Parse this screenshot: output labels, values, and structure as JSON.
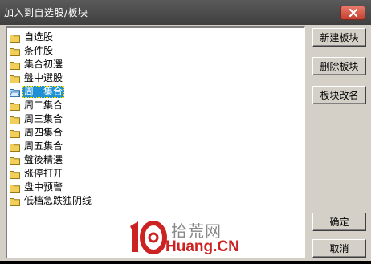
{
  "window": {
    "title": "加入到自选股/板块",
    "close_icon": "close-x-icon"
  },
  "tree": {
    "items": [
      {
        "label": "自选股",
        "icon": "folder-icon",
        "selected": false
      },
      {
        "label": "条件股",
        "icon": "folder-icon",
        "selected": false
      },
      {
        "label": "集合初選",
        "icon": "folder-icon",
        "selected": false
      },
      {
        "label": "盤中選股",
        "icon": "folder-icon",
        "selected": false
      },
      {
        "label": "周一集合",
        "icon": "folder-open-icon",
        "selected": true
      },
      {
        "label": "周二集合",
        "icon": "folder-icon",
        "selected": false
      },
      {
        "label": "周三集合",
        "icon": "folder-icon",
        "selected": false
      },
      {
        "label": "周四集合",
        "icon": "folder-icon",
        "selected": false
      },
      {
        "label": "周五集合",
        "icon": "folder-icon",
        "selected": false
      },
      {
        "label": "盤後精選",
        "icon": "folder-icon",
        "selected": false
      },
      {
        "label": "涨停打开",
        "icon": "folder-icon",
        "selected": false
      },
      {
        "label": "盘中预警",
        "icon": "folder-icon",
        "selected": false
      },
      {
        "label": "低档急跌独阴线",
        "icon": "folder-icon",
        "selected": false
      }
    ]
  },
  "buttons": {
    "new_block": "新建板块",
    "delete_block": "删除板块",
    "rename_block": "板块改名",
    "ok": "确定",
    "cancel": "取消"
  },
  "watermark": {
    "cn_text": "拾荒网",
    "en_text": "Huang.CN"
  },
  "colors": {
    "titlebar": "#4a4a4a",
    "selection": "#1e90d4",
    "dialog_bg": "#d4d0c8",
    "close_button": "#d2503c",
    "folder": "#f2cf5b"
  }
}
